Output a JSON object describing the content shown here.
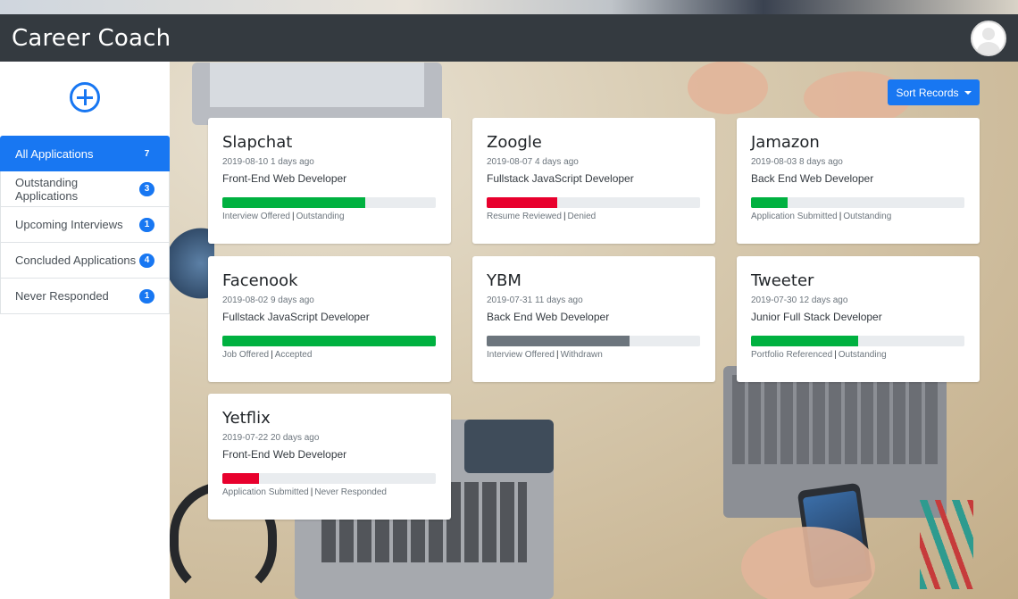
{
  "app": {
    "title": "Career Coach"
  },
  "sidebar": {
    "items": [
      {
        "label": "All Applications",
        "count": "7",
        "active": true
      },
      {
        "label": "Outstanding Applications",
        "count": "3",
        "active": false
      },
      {
        "label": "Upcoming Interviews",
        "count": "1",
        "active": false
      },
      {
        "label": "Concluded Applications",
        "count": "4",
        "active": false
      },
      {
        "label": "Never Responded",
        "count": "1",
        "active": false
      }
    ]
  },
  "toolbar": {
    "sort_label": "Sort Records"
  },
  "colors": {
    "primary": "#1877f2",
    "navbar": "#343a40",
    "success": "#00b140",
    "danger": "#e8002d",
    "secondary": "#6c757d"
  },
  "cards": [
    {
      "company": "Slapchat",
      "date": "2019-08-10",
      "ago": "1 days ago",
      "position": "Front-End Web Developer",
      "stage": "Interview Offered",
      "state": "Outstanding",
      "progress": 0.67,
      "color": "#00b140"
    },
    {
      "company": "Zoogle",
      "date": "2019-08-07",
      "ago": "4 days ago",
      "position": "Fullstack JavaScript Developer",
      "stage": "Resume Reviewed",
      "state": "Denied",
      "progress": 0.33,
      "color": "#e8002d"
    },
    {
      "company": "Jamazon",
      "date": "2019-08-03",
      "ago": "8 days ago",
      "position": "Back End Web Developer",
      "stage": "Application Submitted",
      "state": "Outstanding",
      "progress": 0.17,
      "color": "#00b140"
    },
    {
      "company": "Facenook",
      "date": "2019-08-02",
      "ago": "9 days ago",
      "position": "Fullstack JavaScript Developer",
      "stage": "Job Offered",
      "state": "Accepted",
      "progress": 1.0,
      "color": "#00b140"
    },
    {
      "company": "YBM",
      "date": "2019-07-31",
      "ago": "11 days ago",
      "position": "Back End Web Developer",
      "stage": "Interview Offered",
      "state": "Withdrawn",
      "progress": 0.67,
      "color": "#6c757d"
    },
    {
      "company": "Tweeter",
      "date": "2019-07-30",
      "ago": "12 days ago",
      "position": "Junior Full Stack Developer",
      "stage": "Portfolio Referenced",
      "state": "Outstanding",
      "progress": 0.5,
      "color": "#00b140"
    },
    {
      "company": "Yetflix",
      "date": "2019-07-22",
      "ago": "20 days ago",
      "position": "Front-End Web Developer",
      "stage": "Application Submitted",
      "state": "Never Responded",
      "progress": 0.17,
      "color": "#e8002d"
    }
  ]
}
